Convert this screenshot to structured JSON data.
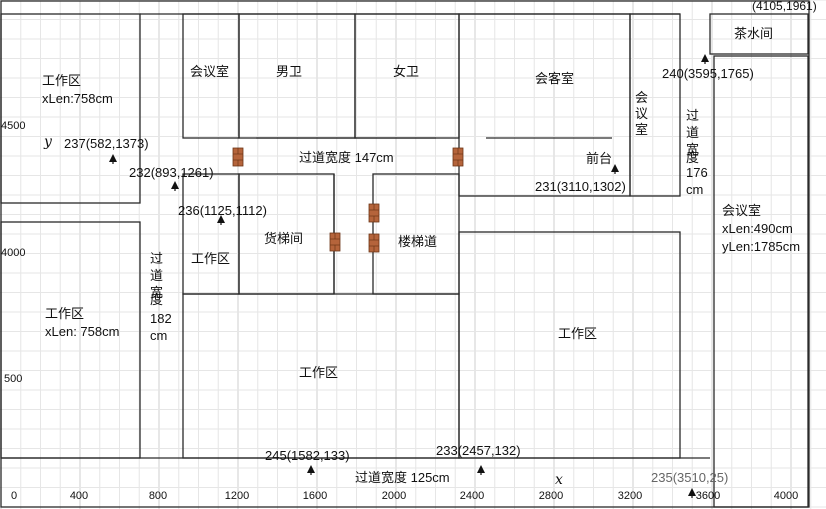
{
  "axes": {
    "x_name": "x",
    "y_name": "y"
  },
  "x_ticks": [
    "0",
    "400",
    "800",
    "1200",
    "1600",
    "2000",
    "2400",
    "2800",
    "3200",
    "3600",
    "4000"
  ],
  "y_ticks": [
    "4500",
    "4000",
    "500"
  ],
  "rooms": {
    "workarea_top_left": {
      "name": "工作区",
      "size": "xLen:758cm"
    },
    "workarea_left": {
      "name": "工作区",
      "size": "xLen: 758cm"
    },
    "meeting_room_1": "会议室",
    "mens_room": "男卫",
    "womens_room": "女卫",
    "reception_room": "会客室",
    "meeting_room_2": [
      "会",
      "议",
      "室"
    ],
    "tea_room": "茶水间",
    "front_desk": "前台",
    "freight_elevator": "货梯间",
    "stairway": "楼梯道",
    "workarea_small": "工作区",
    "workarea_bottom_mid": "工作区",
    "workarea_right": "工作区",
    "meeting_room_big": {
      "name": "会议室",
      "xlen": "xLen:490cm",
      "ylen": "yLen:1785cm"
    }
  },
  "corridors": {
    "top": "过道宽度 147cm",
    "bottom": "过道宽度 125cm",
    "left": [
      "过",
      "道",
      "宽",
      "度",
      "182",
      "cm"
    ],
    "right": [
      "过",
      "道",
      "宽",
      "度",
      "176",
      "cm"
    ]
  },
  "points": [
    {
      "label": "237(582,1373)"
    },
    {
      "label": "232(893,1261)"
    },
    {
      "label": "236(1125,1112)"
    },
    {
      "label": "231(3110,1302)"
    },
    {
      "label": "240(3595,1765)"
    },
    {
      "label": "245(1582,133)"
    },
    {
      "label": "233(2457,132)"
    },
    {
      "label": "235(3510,25)"
    },
    {
      "label": "(4105,1961)"
    }
  ],
  "colors": {
    "door": "#b5643b",
    "line": "#2a2a2a",
    "grid": "#e6e6e6"
  }
}
